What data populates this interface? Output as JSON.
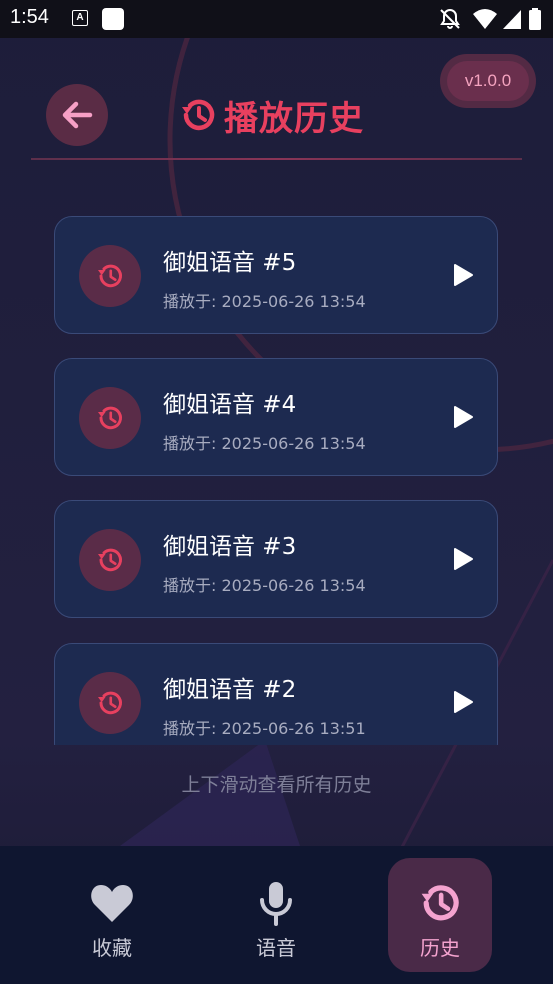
{
  "status_bar": {
    "time": "1:54",
    "icons": [
      "a-notification-icon",
      "app-notification-icon",
      "do-not-disturb-icon",
      "wifi-icon",
      "signal-icon",
      "battery-icon"
    ]
  },
  "header": {
    "back_icon": "arrow-left-icon",
    "title_icon": "history-icon",
    "title": "播放历史",
    "version": "v1.0.0"
  },
  "history": {
    "items": [
      {
        "title": "御姐语音 #5",
        "played_at": "播放于: 2025-06-26 13:54"
      },
      {
        "title": "御姐语音 #4",
        "played_at": "播放于: 2025-06-26 13:54"
      },
      {
        "title": "御姐语音 #3",
        "played_at": "播放于: 2025-06-26 13:54"
      },
      {
        "title": "御姐语音 #2",
        "played_at": "播放于: 2025-06-26 13:51"
      }
    ],
    "scroll_hint": "上下滑动查看所有历史"
  },
  "bottom_nav": {
    "items": [
      {
        "label": "收藏",
        "icon": "heart-icon",
        "active": false
      },
      {
        "label": "语音",
        "icon": "microphone-icon",
        "active": false
      },
      {
        "label": "历史",
        "icon": "history-icon",
        "active": true
      }
    ]
  },
  "colors": {
    "accent": "#e8405f",
    "active_nav": "#f4a3cf",
    "card_background": "#1d2a50",
    "nav_background": "#0f1630"
  }
}
